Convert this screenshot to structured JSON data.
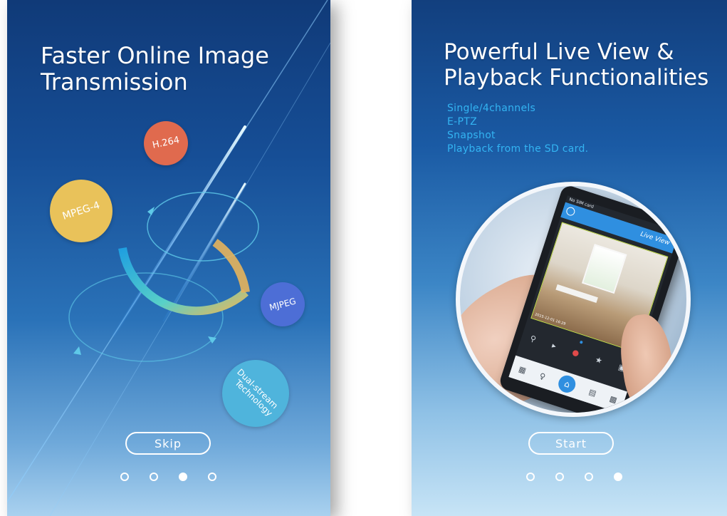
{
  "slides": [
    {
      "title": "Faster Online Image\nTransmission",
      "bubbles": {
        "h264": "H.264",
        "mpeg4": "MPEG-4",
        "mjpeg": "MJPEG",
        "dual_line1": "Dual-stream",
        "dual_line2": "Technology"
      },
      "button_label": "Skip",
      "pager_active_index": 2
    },
    {
      "title": "Powerful Live View &\nPlayback Functionalities",
      "features": [
        "Single/4channels",
        "E-PTZ",
        "Snapshot",
        "Playback from the SD card."
      ],
      "phone": {
        "status_text": "No SIM card",
        "screen_title": "Live View",
        "camera_timestamp": "2015-12-01 16:29"
      },
      "button_label": "Start",
      "pager_active_index": 3
    }
  ],
  "pager_dot_count": 4,
  "colors": {
    "feature_text": "#33b4f2",
    "bubble_h264": "#e06a4e",
    "bubble_mpeg4": "#e9c25a",
    "bubble_mjpeg": "#4d6ed6",
    "bubble_dual": "#4fb4dc",
    "app_accent": "#2f8fe0"
  },
  "icons": {
    "phone_toolbar": [
      "zoom-icon",
      "speaker-icon",
      "microphone-icon",
      "star-icon",
      "snapshot-icon"
    ],
    "phone_bottom_bar": [
      "gallery-icon",
      "person-icon",
      "home-icon",
      "list-icon",
      "camera-icon"
    ]
  }
}
